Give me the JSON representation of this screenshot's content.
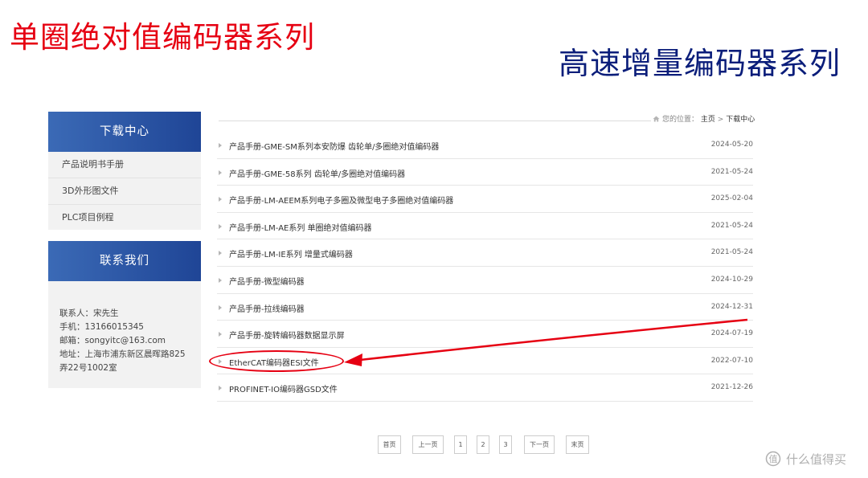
{
  "colors": {
    "headline_left": "#e60012",
    "headline_right": "#0a1d7a",
    "sidebar_header_gradient": [
      "#3b6ab6",
      "#1f4596"
    ],
    "callout": "#e60012"
  },
  "headlines": {
    "left": "单圈绝对值编码器系列",
    "right": "高速增量编码器系列"
  },
  "sidebar": {
    "download": {
      "title": "下载中心",
      "items": [
        {
          "label": "产品说明书手册"
        },
        {
          "label": "3D外形图文件"
        },
        {
          "label": "PLC项目例程"
        }
      ]
    },
    "contact": {
      "title": "联系我们",
      "contact_person": "联系人：宋先生",
      "phone": "手机：13166015345",
      "email": "邮箱：songyitc@163.com",
      "address": "地址：上海市浦东新区晨晖路825弄22号1002室"
    }
  },
  "breadcrumb": {
    "icon": "home-icon",
    "prefix": "您的位置：",
    "home": "主页",
    "separator": ">",
    "current": "下载中心"
  },
  "files": [
    {
      "title": "产品手册-GME-SM系列本安防爆 齿轮单/多圈绝对值编码器",
      "date": "2024-05-20"
    },
    {
      "title": "产品手册-GME-58系列 齿轮单/多圈绝对值编码器",
      "date": "2021-05-24"
    },
    {
      "title": "产品手册-LM-AEEM系列电子多圈及微型电子多圈绝对值编码器",
      "date": "2025-02-04"
    },
    {
      "title": "产品手册-LM-AE系列 单圈绝对值编码器",
      "date": "2021-05-24"
    },
    {
      "title": "产品手册-LM-IE系列 增量式编码器",
      "date": "2021-05-24"
    },
    {
      "title": "产品手册-微型编码器",
      "date": "2024-10-29"
    },
    {
      "title": "产品手册-拉线编码器",
      "date": "2024-12-31"
    },
    {
      "title": "产品手册-旋转编码器数据显示屏",
      "date": "2024-07-19"
    },
    {
      "title": "EtherCAT编码器ESI文件",
      "date": "2022-07-10",
      "highlighted": true
    },
    {
      "title": "PROFINET-IO编码器GSD文件",
      "date": "2021-12-26"
    }
  ],
  "pagination": {
    "first": "首页",
    "prev": "上一页",
    "pages": [
      "1",
      "2",
      "3"
    ],
    "next": "下一页",
    "last": "末页"
  },
  "watermark": {
    "icon": "zhi-logo-icon",
    "text": "什么值得买"
  }
}
